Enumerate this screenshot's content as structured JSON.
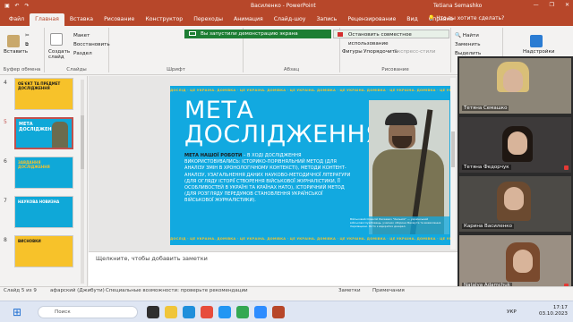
{
  "window": {
    "doc_title": "Василенко  -  PowerPoint",
    "user_name": "Tetiana Semashko",
    "help_prompt": "Что вы хотите сделать?",
    "controls": [
      "—",
      "❐",
      "✕"
    ]
  },
  "tabs": [
    "Файл",
    "Главная",
    "Вставка",
    "Рисование",
    "Конструктор",
    "Переходы",
    "Анимация",
    "Слайд-шоу",
    "Запись",
    "Рецензирование",
    "Вид",
    "Справка"
  ],
  "active_tab": "Главная",
  "banners": {
    "demo": "Вы запустили демонстрацию экрана",
    "stop": "Остановить совместное использование"
  },
  "ribbon": {
    "paste": "Вставить",
    "create_slide": "Создать слайд",
    "layout": "Макет",
    "restore": "Восстановить",
    "section": "Раздел",
    "shapes": "Фигуры",
    "arrange": "Упорядочить",
    "express_styles": "Экспресс-стили",
    "find": "Найти",
    "replace": "Заменить",
    "select": "Выделить",
    "addins": "Надстройки",
    "groups": {
      "clipboard": "Буфер обмена",
      "slides": "Слайды",
      "font": "Шрифт",
      "paragraph": "Абзац",
      "drawing": "Рисование",
      "editing": "Редактирование",
      "addins": "Надстройки"
    }
  },
  "thumbnails": [
    {
      "num": "4",
      "title": "ОБ'ЄКТ ТА ПРЕДМЕТ ДОСЛІДЖЕННЯ",
      "color": "#f7c22a"
    },
    {
      "num": "5",
      "title": "МЕТА ДОСЛІДЖЕННЯ",
      "color": "#0fa8d8"
    },
    {
      "num": "6",
      "title": "ЗАВДАННЯ ДОСЛІДЖЕННЯ",
      "color": "#0fa8d8"
    },
    {
      "num": "7",
      "title": "НАУКОВА НОВИЗНА",
      "color": "#0fa8d8"
    },
    {
      "num": "8",
      "title": "ВИСНОВКИ",
      "color": "#f7c22a"
    }
  ],
  "slide": {
    "strip_text": "ДОСЛІД · ЦЕ УКРАЇНА. ДОМІВКА · ЦЕ УКРАЇНА. ДОМІВКА · ЦЕ УКРАЇНА. ДОМІВКА · ЦЕ УКРАЇНА. ДОМІВКА · ЦЕ УКРАЇНА. ДОМІВКА · ЦЕ УКРАЇНА. ДОМІВКА",
    "title_line1": "МЕТА",
    "title_line2": "ДОСЛІДЖЕННЯ",
    "body_lead": "МЕТА НАШОЇ РОБОТИ",
    "body_text": " – В ХОДІ ДОСЛІДЖЕННЯ ВИКОРИСТОВУВАЛИСЬ: ІСТОРИКО-ПОРІВНЯЛЬНИЙ МЕТОД (ДЛЯ АНАЛІЗУ ЗМІН В ХРОНОЛОГІЧНОМУ КОНТЕКСТІ), МЕТОДИ КОНТЕНТ-АНАЛІЗУ, УЗАГАЛЬНЕННЯ ДАНИХ НАУКОВО-МЕТОДИЧНОЇ ЛІТЕРАТУРИ (ДЛЯ ОГЛЯДУ ІСТОРІЇ СТВОРЕННЯ ВІЙСЬКОВОЇ ЖУРНАЛІСТИКИ, ЇЇ ОСОБЛИВОСТЕЙ В УКРАЇНІ ТА КРАЇНАХ НАТО), ІСТОРИЧНИЙ МЕТОД (ДЛЯ РОЗГЛЯДУ ПЕРЕДУМОВ СТАНОВЛЕННЯ УКРАЇНСЬКОЇ ВІЙСЬКОВОЇ ЖУРНАЛІСТИКИ).",
    "caption": "Військовий Олексій Ласкевич \"Хельміх\" — український військовослужбовець, учасник оборони Бахмута та визволення Харківщини. Фото з відкритих джерел."
  },
  "notes_placeholder": "Щелкните, чтобы добавить заметки",
  "participants": [
    {
      "name": "Тетяна Семашко"
    },
    {
      "name": "Тетяна Федорчук"
    },
    {
      "name": "Карина Василенко"
    },
    {
      "name": "Natalya Adamchuk"
    }
  ],
  "status": {
    "slide": "Слайд 5 из 9",
    "language": "афарский (Джибути)",
    "accessibility": "Специальные возможности: проверьте рекомендации",
    "notes": "Заметки",
    "comments": "Примечания"
  },
  "taskbar": {
    "search": "Поиск",
    "lang": "УКР",
    "time": "17:17",
    "date": "03.10.2023"
  }
}
